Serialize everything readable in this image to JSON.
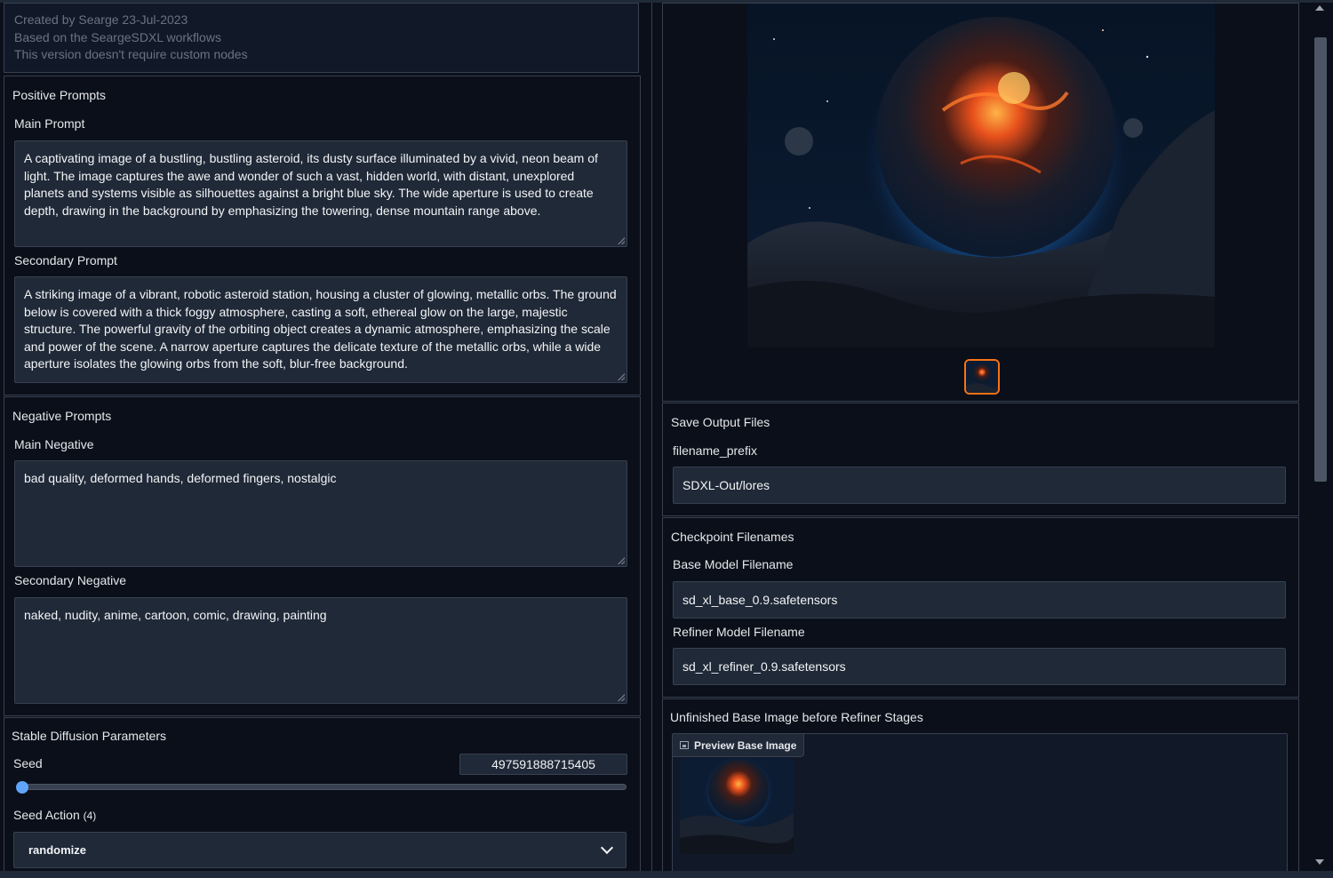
{
  "info": {
    "line1": "Created by Searge 23-Jul-2023",
    "line2": "Based on the SeargeSDXL workflows",
    "line3": "This version doesn't require custom nodes"
  },
  "positive": {
    "title": "Positive Prompts",
    "main_label": "Main Prompt",
    "main_value": "A captivating image of a bustling, bustling asteroid, its dusty surface illuminated by a vivid, neon beam of light. The image captures the awe and wonder of such a vast, hidden world, with distant, unexplored planets and systems visible as silhouettes against a bright blue sky. The wide aperture is used to create depth, drawing in the background by emphasizing the towering, dense mountain range above.",
    "secondary_label": "Secondary Prompt",
    "secondary_value": "A striking image of a vibrant, robotic asteroid station, housing a cluster of glowing, metallic orbs. The ground below is covered with a thick foggy atmosphere, casting a soft, ethereal glow on the large, majestic structure. The powerful gravity of the orbiting object creates a dynamic atmosphere, emphasizing the scale and power of the scene. A narrow aperture captures the delicate texture of the metallic orbs, while a wide aperture isolates the glowing orbs from the soft, blur-free background."
  },
  "negative": {
    "title": "Negative Prompts",
    "main_label": "Main Negative",
    "main_value": "bad quality, deformed hands, deformed fingers, nostalgic",
    "secondary_label": "Secondary Negative",
    "secondary_value": "naked, nudity, anime, cartoon, comic, drawing, painting"
  },
  "sd_params": {
    "title": "Stable Diffusion Parameters",
    "seed_label": "Seed",
    "seed_value": "497591888715405",
    "seed_slider_fraction": 0.0,
    "seed_action_label": "Seed Action",
    "seed_action_count": "(4)",
    "seed_action_value": "randomize"
  },
  "gallery": {
    "main_image_icon": "asteroid-image",
    "thumb_icon": "asteroid-thumbnail"
  },
  "save_output": {
    "title": "Save Output Files",
    "prefix_label": "filename_prefix",
    "prefix_value": "SDXL-Out/lores"
  },
  "checkpoints": {
    "title": "Checkpoint Filenames",
    "base_label": "Base Model Filename",
    "base_value": "sd_xl_base_0.9.safetensors",
    "refiner_label": "Refiner Model Filename",
    "refiner_value": "sd_xl_refiner_0.9.safetensors"
  },
  "unfinished": {
    "title": "Unfinished Base Image before Refiner Stages",
    "preview_label": "Preview Base Image",
    "preview_icon": "image-icon"
  },
  "colors": {
    "background": "#0b0f19",
    "panel": "#1f2937",
    "border": "#374151",
    "accent": "#60a5fa",
    "selected_thumb": "#f97316"
  }
}
